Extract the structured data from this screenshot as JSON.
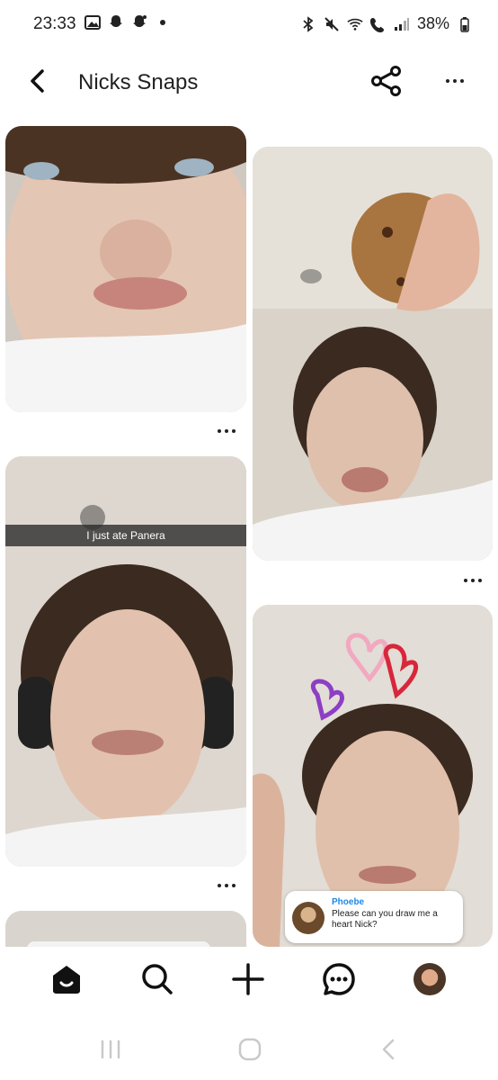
{
  "status_bar": {
    "time": "23:33",
    "left_icons": [
      "gallery-icon",
      "snapchat-ghost-icon",
      "snapchat-ghost-plus-icon",
      "dot-icon"
    ],
    "right_icons": [
      "bluetooth-icon",
      "mute-icon",
      "wifi-icon",
      "wifi-calling-icon",
      "signal-icon"
    ],
    "battery_percent": "38%"
  },
  "header": {
    "title": "Nicks Snaps",
    "back_icon": "chevron-left-icon",
    "share_icon": "share-icon",
    "more_icon": "more-horizontal-icon"
  },
  "snaps": [
    {
      "id": "snap-1",
      "colors": {
        "bg": "#d8d2cb",
        "accent": "#e9d2c3"
      }
    },
    {
      "id": "snap-2",
      "colors": {
        "bg": "#cfc8bd",
        "accent": "#8b5a2b"
      }
    },
    {
      "id": "snap-3",
      "colors": {
        "bg": "#d7d0c6",
        "accent": "#e7c9b6"
      },
      "caption": "I just ate Panera"
    },
    {
      "id": "snap-4",
      "colors": {
        "bg": "#dcd6cf",
        "accent": "#e6c7b3"
      },
      "reply": {
        "name": "Phoebe",
        "text": "Please can you draw me a heart Nick?"
      }
    },
    {
      "id": "snap-5",
      "colors": {
        "bg": "#d9d4cd",
        "accent": "#cfc7bd"
      }
    }
  ],
  "bottom_nav": {
    "items": [
      "home-icon",
      "search-icon",
      "add-icon",
      "chat-icon",
      "profile-avatar"
    ]
  },
  "system_nav": {
    "items": [
      "recents-icon",
      "home-circle-icon",
      "back-icon"
    ]
  }
}
